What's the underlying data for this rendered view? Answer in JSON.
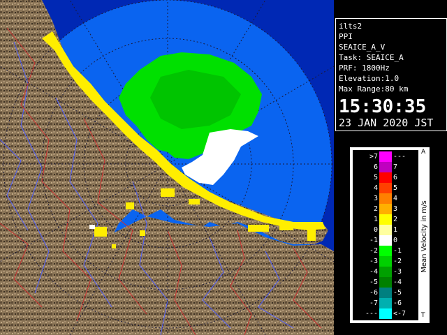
{
  "info": {
    "site": "ilts2",
    "mode": "PPI",
    "product": "SEAICE_A_V",
    "task": "Task: SEAICE_A",
    "prf": "PRF: 1800Hz",
    "elevation": "Elevation:1.0",
    "max_range": "Max Range:80 km",
    "time": "15:30:35",
    "date": "23 JAN 2020 JST"
  },
  "legend": {
    "title": "Mean Velocity in m/s",
    "top_marker": "A",
    "bottom_marker": "T",
    "rows": [
      {
        "lo": ">7",
        "hi": "---",
        "color": "#ff00ff"
      },
      {
        "lo": "6",
        "hi": "7",
        "color": "#c000c0"
      },
      {
        "lo": "5",
        "hi": "6",
        "color": "#ff0000"
      },
      {
        "lo": "4",
        "hi": "5",
        "color": "#ff4000"
      },
      {
        "lo": "3",
        "hi": "4",
        "color": "#ff8000"
      },
      {
        "lo": "2",
        "hi": "3",
        "color": "#ffb000"
      },
      {
        "lo": "1",
        "hi": "2",
        "color": "#ffff00"
      },
      {
        "lo": "0",
        "hi": "1",
        "color": "#ffffa0"
      },
      {
        "lo": "-1",
        "hi": "0",
        "color": "#ffffff"
      },
      {
        "lo": "-2",
        "hi": "-1",
        "color": "#00ff00"
      },
      {
        "lo": "-3",
        "hi": "-2",
        "color": "#00d000"
      },
      {
        "lo": "-4",
        "hi": "-3",
        "color": "#00a000"
      },
      {
        "lo": "-5",
        "hi": "-4",
        "color": "#008000"
      },
      {
        "lo": "-6",
        "hi": "-5",
        "color": "#008080"
      },
      {
        "lo": "-7",
        "hi": "-6",
        "color": "#00b0b0"
      },
      {
        "lo": "---",
        "hi": "<-7",
        "color": "#00ffff"
      }
    ]
  },
  "colors": {
    "range_ring_fill": "#0a64f0",
    "sea_dark": "#0028b4",
    "land": "#8a7456",
    "echo_green": "#00ff00",
    "echo_yellow": "#ffee00",
    "echo_white": "#ffffff",
    "river": "#5060ff",
    "border": "#cc3030"
  }
}
